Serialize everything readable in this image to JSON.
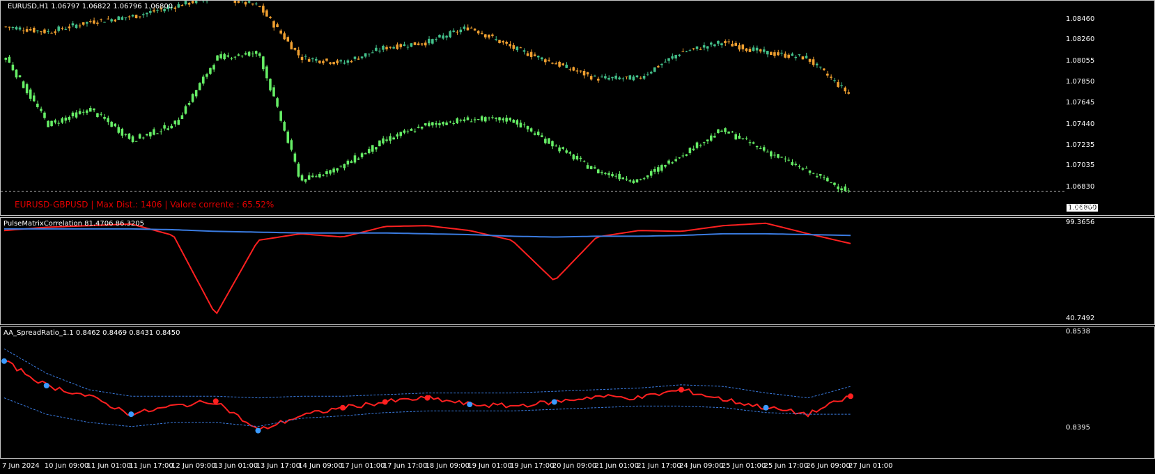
{
  "main_panel": {
    "title": "EURUSD,H1  1.06797 1.06822 1.06796 1.06800",
    "overlay_text": "EURUSD-GBPUSD | Max Dist.: 1406 | Valore corrente : 65.52%",
    "current_price_tag": "1.06800",
    "colors": {
      "bull": "#43c08a",
      "bear": "#f0a030",
      "second_symbol": "#66ee66",
      "dashed_line": "#aaaaaa"
    }
  },
  "correlation_panel": {
    "title": "PulseMatrixCorrelation 81.4706 86.3205",
    "colors": {
      "series_red": "#ff2020",
      "series_blue": "#3a7be0"
    }
  },
  "spread_panel": {
    "title": "AA_SpreadRatio_1.1 0.8462 0.8469 0.8431 0.8450",
    "colors": {
      "main": "#ff2020",
      "bands": "#3a7be0",
      "up_dot": "#ff2020",
      "down_dot": "#3a9bff"
    }
  },
  "time_axis": [
    "7 Jun 2024",
    "10 Jun 09:00",
    "11 Jun 01:00",
    "11 Jun 17:00",
    "12 Jun 09:00",
    "13 Jun 01:00",
    "13 Jun 17:00",
    "14 Jun 09:00",
    "17 Jun 01:00",
    "17 Jun 17:00",
    "18 Jun 09:00",
    "19 Jun 01:00",
    "19 Jun 17:00",
    "20 Jun 09:00",
    "21 Jun 01:00",
    "21 Jun 17:00",
    "24 Jun 09:00",
    "25 Jun 01:00",
    "25 Jun 17:00",
    "26 Jun 09:00",
    "27 Jun 01:00"
  ],
  "chart_data": [
    {
      "type": "line",
      "title": "EURUSD,H1  1.06797 1.06822 1.06796 1.06800",
      "ylim": [
        1.06625,
        1.086
      ],
      "y_ticks": [
        "1.08460",
        "1.08260",
        "1.08055",
        "1.07850",
        "1.07645",
        "1.07440",
        "1.07235",
        "1.07035",
        "1.06830",
        "1.06625"
      ],
      "series": [
        {
          "name": "EURUSD",
          "x": [
            "7 Jun 2024",
            "10 Jun 09:00",
            "11 Jun 01:00",
            "11 Jun 17:00",
            "12 Jun 09:00",
            "13 Jun 01:00",
            "13 Jun 17:00",
            "14 Jun 09:00",
            "17 Jun 01:00",
            "17 Jun 17:00",
            "18 Jun 09:00",
            "19 Jun 01:00",
            "19 Jun 17:00",
            "20 Jun 09:00",
            "21 Jun 01:00",
            "21 Jun 17:00",
            "24 Jun 09:00",
            "25 Jun 01:00",
            "25 Jun 17:00",
            "26 Jun 09:00",
            "27 Jun 01:00"
          ],
          "values": [
            1.084,
            1.0835,
            1.0845,
            1.085,
            1.086,
            1.087,
            1.086,
            1.081,
            1.0805,
            1.082,
            1.0825,
            1.084,
            1.082,
            1.0805,
            1.079,
            1.079,
            1.0815,
            1.0825,
            1.0815,
            1.081,
            1.0775
          ]
        },
        {
          "values": [
            1.081,
            1.0745,
            1.076,
            1.073,
            1.0745,
            1.081,
            1.0815,
            1.069,
            1.0705,
            1.073,
            1.0745,
            1.075,
            1.075,
            1.0725,
            1.07,
            1.069,
            1.0715,
            1.074,
            1.072,
            1.07,
            1.068
          ]
        }
      ]
    },
    {
      "type": "line",
      "title": "PulseMatrixCorrelation 81.4706 86.3205",
      "ylim": [
        40.7492,
        99.3656
      ],
      "y_ticks": [
        "99.3656",
        "40.7492"
      ],
      "series": [
        {
          "values": [
            95.0,
            97.0,
            98.0,
            99.0,
            92.0,
            43.0,
            89.0,
            93.0,
            91.0,
            97.5,
            98.0,
            95.0,
            89.0,
            64.0,
            91.0,
            95.0,
            94.5,
            98.0,
            99.5,
            93.0,
            87.0
          ]
        },
        {
          "values": [
            96.0,
            96.0,
            96.0,
            96.0,
            95.5,
            94.5,
            94.0,
            93.5,
            93.5,
            93.5,
            93.0,
            92.5,
            91.5,
            91.0,
            91.5,
            91.5,
            92.0,
            93.0,
            93.0,
            92.5,
            92.0
          ]
        }
      ]
    },
    {
      "type": "line",
      "title": "AA_SpreadRatio_1.1 0.8462 0.8469 0.8431 0.8450",
      "ylim": [
        0.8395,
        0.8538
      ],
      "y_ticks": [
        "0.8538",
        "0.8395"
      ],
      "series": [
        {
          "values": [
            0.8505,
            0.8475,
            0.8462,
            0.844,
            0.845,
            0.8456,
            0.842,
            0.8438,
            0.8448,
            0.8455,
            0.846,
            0.8452,
            0.845,
            0.8455,
            0.8462,
            0.846,
            0.847,
            0.8458,
            0.8448,
            0.844,
            0.8462
          ]
        },
        {
          "values": [
            0.852,
            0.849,
            0.847,
            0.8462,
            0.8462,
            0.8462,
            0.846,
            0.8462,
            0.8462,
            0.8464,
            0.8466,
            0.8466,
            0.8466,
            0.8468,
            0.847,
            0.8472,
            0.8476,
            0.8474,
            0.8466,
            0.846,
            0.8474
          ]
        },
        {
          "values": [
            0.846,
            0.844,
            0.843,
            0.8425,
            0.843,
            0.843,
            0.8425,
            0.8435,
            0.8438,
            0.8442,
            0.8444,
            0.8444,
            0.8444,
            0.8446,
            0.8448,
            0.845,
            0.845,
            0.8448,
            0.8442,
            0.844,
            0.844
          ]
        }
      ]
    }
  ]
}
